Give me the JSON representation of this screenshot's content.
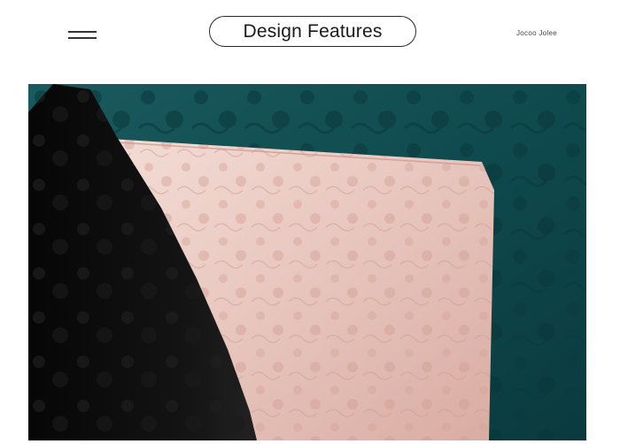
{
  "header": {
    "menu_icon": "hamburger-menu-icon",
    "title": "Design Features",
    "brand": "Jocoo Jolee"
  },
  "photo": {
    "subject": "fabric-closeup",
    "colors": {
      "teal": "#0f4a4e",
      "black": "#0b0b0b",
      "blush": "#e7c5bd"
    }
  }
}
